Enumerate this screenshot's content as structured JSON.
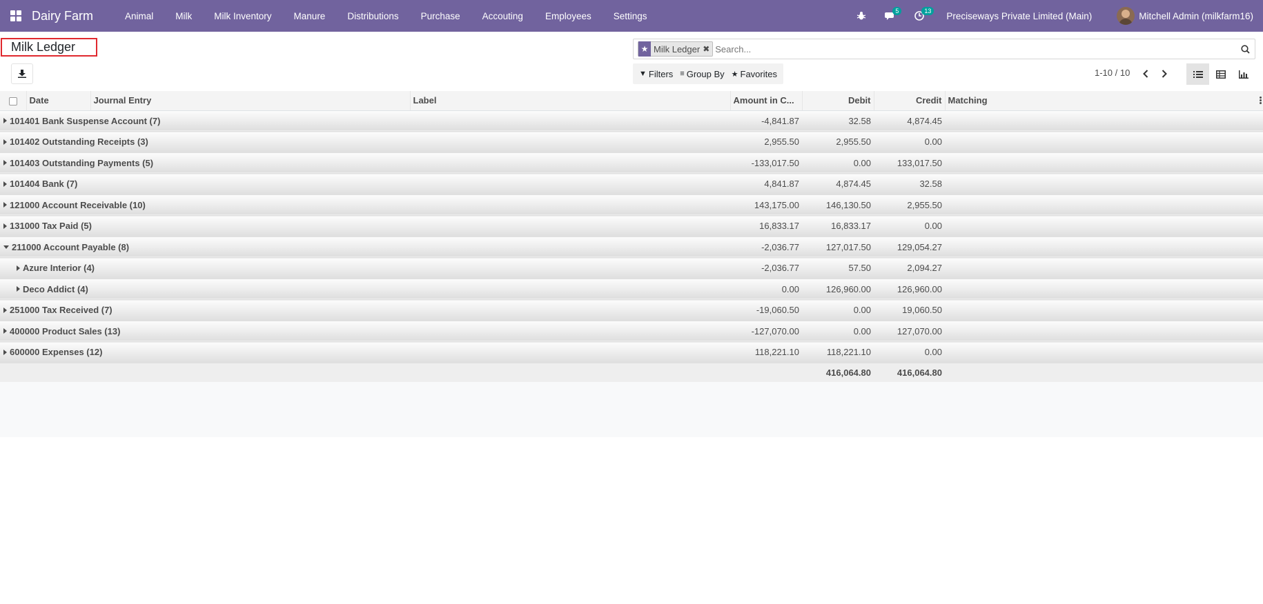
{
  "navbar": {
    "brand": "Dairy Farm",
    "menu": [
      "Animal",
      "Milk",
      "Milk Inventory",
      "Manure",
      "Distributions",
      "Purchase",
      "Accouting",
      "Employees",
      "Settings"
    ],
    "messages_count": "5",
    "activities_count": "13",
    "company": "Preciseways Private Limited (Main)",
    "user": "Mitchell Admin (milkfarm16)"
  },
  "control_panel": {
    "title": "Milk Ledger",
    "search": {
      "facet": "Milk Ledger",
      "placeholder": "Search..."
    },
    "filters_label": "Filters",
    "group_by_label": "Group By",
    "favorites_label": "Favorites",
    "pager": "1-10 / 10"
  },
  "table": {
    "columns": [
      "Date",
      "Journal Entry",
      "Label",
      "Amount in C...",
      "Debit",
      "Credit",
      "Matching"
    ],
    "rows": [
      {
        "name": "101401 Bank Suspense Account (7)",
        "amount": "-4,841.87",
        "debit": "32.58",
        "credit": "4,874.45",
        "expanded": false,
        "level": 0
      },
      {
        "name": "101402 Outstanding Receipts (3)",
        "amount": "2,955.50",
        "debit": "2,955.50",
        "credit": "0.00",
        "expanded": false,
        "level": 0
      },
      {
        "name": "101403 Outstanding Payments (5)",
        "amount": "-133,017.50",
        "debit": "0.00",
        "credit": "133,017.50",
        "expanded": false,
        "level": 0
      },
      {
        "name": "101404 Bank (7)",
        "amount": "4,841.87",
        "debit": "4,874.45",
        "credit": "32.58",
        "expanded": false,
        "level": 0
      },
      {
        "name": "121000 Account Receivable (10)",
        "amount": "143,175.00",
        "debit": "146,130.50",
        "credit": "2,955.50",
        "expanded": false,
        "level": 0
      },
      {
        "name": "131000 Tax Paid (5)",
        "amount": "16,833.17",
        "debit": "16,833.17",
        "credit": "0.00",
        "expanded": false,
        "level": 0
      },
      {
        "name": "211000 Account Payable (8)",
        "amount": "-2,036.77",
        "debit": "127,017.50",
        "credit": "129,054.27",
        "expanded": true,
        "level": 0
      },
      {
        "name": "Azure Interior (4)",
        "amount": "-2,036.77",
        "debit": "57.50",
        "credit": "2,094.27",
        "expanded": false,
        "level": 1
      },
      {
        "name": "Deco Addict (4)",
        "amount": "0.00",
        "debit": "126,960.00",
        "credit": "126,960.00",
        "expanded": false,
        "level": 1
      },
      {
        "name": "251000 Tax Received (7)",
        "amount": "-19,060.50",
        "debit": "0.00",
        "credit": "19,060.50",
        "expanded": false,
        "level": 0
      },
      {
        "name": "400000 Product Sales (13)",
        "amount": "-127,070.00",
        "debit": "0.00",
        "credit": "127,070.00",
        "expanded": false,
        "level": 0
      },
      {
        "name": "600000 Expenses (12)",
        "amount": "118,221.10",
        "debit": "118,221.10",
        "credit": "0.00",
        "expanded": false,
        "level": 0
      }
    ],
    "totals": {
      "debit": "416,064.80",
      "credit": "416,064.80"
    }
  }
}
